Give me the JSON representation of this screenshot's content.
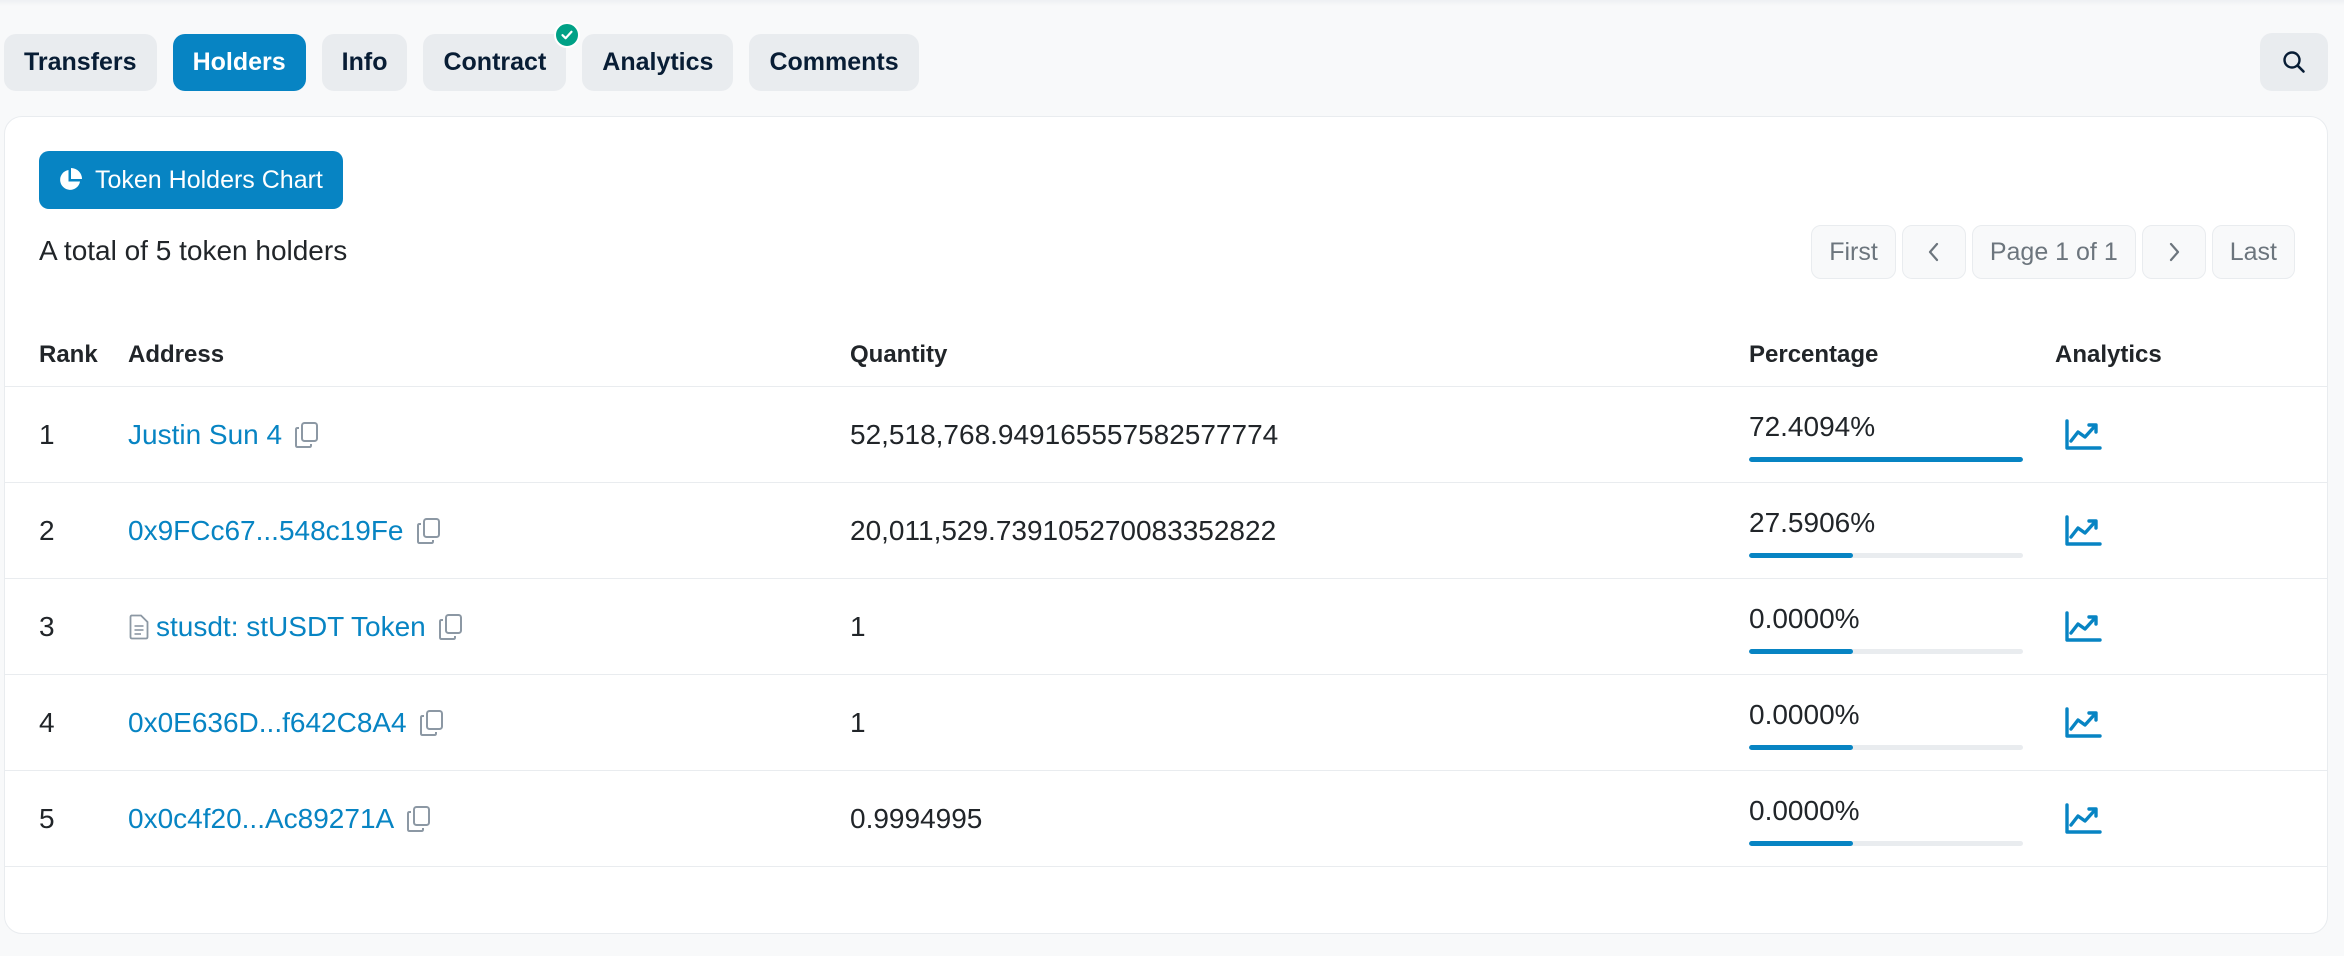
{
  "tabs": [
    {
      "label": "Transfers",
      "active": false
    },
    {
      "label": "Holders",
      "active": true
    },
    {
      "label": "Info",
      "active": false
    },
    {
      "label": "Contract",
      "active": false,
      "verified": true
    },
    {
      "label": "Analytics",
      "active": false
    },
    {
      "label": "Comments",
      "active": false
    }
  ],
  "chart_button_label": "Token Holders Chart",
  "summary": "A total of 5 token holders",
  "pagination": {
    "first": "First",
    "page_label": "Page 1 of 1",
    "last": "Last"
  },
  "table": {
    "headers": {
      "rank": "Rank",
      "address": "Address",
      "quantity": "Quantity",
      "percentage": "Percentage",
      "analytics": "Analytics"
    },
    "rows": [
      {
        "rank": "1",
        "address": "Justin Sun 4",
        "is_contract": false,
        "quantity": "52,518,768.949165557582577774",
        "percentage": "72.4094%",
        "bar_fill_percent": 100
      },
      {
        "rank": "2",
        "address": "0x9FCc67...548c19Fe",
        "is_contract": false,
        "quantity": "20,011,529.739105270083352822",
        "percentage": "27.5906%",
        "bar_fill_percent": 38
      },
      {
        "rank": "3",
        "address": "stusdt: stUSDT Token",
        "is_contract": true,
        "quantity": "1",
        "percentage": "0.0000%",
        "bar_fill_percent": 38
      },
      {
        "rank": "4",
        "address": "0x0E636D...f642C8A4",
        "is_contract": false,
        "quantity": "1",
        "percentage": "0.0000%",
        "bar_fill_percent": 38
      },
      {
        "rank": "5",
        "address": "0x0c4f20...Ac89271A",
        "is_contract": false,
        "quantity": "0.9994995",
        "percentage": "0.0000%",
        "bar_fill_percent": 38
      }
    ]
  },
  "colors": {
    "accent": "#0784c3",
    "verified": "#00a186",
    "tab_bg": "#e9ecef"
  },
  "icons": {
    "search": "search-icon",
    "pie": "pie-chart-icon",
    "copy": "copy-icon",
    "analytics": "line-chart-icon",
    "contract": "document-icon",
    "check": "check-icon"
  }
}
